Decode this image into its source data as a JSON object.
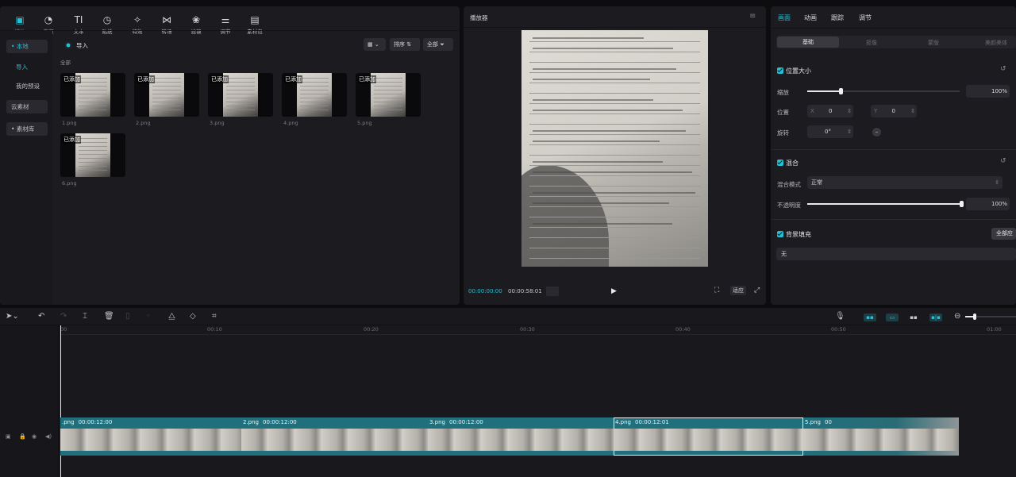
{
  "toolbar": {
    "items": [
      {
        "label": "媒体",
        "icon": "media-icon"
      },
      {
        "label": "音频",
        "icon": "audio-icon"
      },
      {
        "label": "文本",
        "icon": "text-icon"
      },
      {
        "label": "贴纸",
        "icon": "sticker-icon"
      },
      {
        "label": "特效",
        "icon": "effects-icon"
      },
      {
        "label": "转场",
        "icon": "transition-icon"
      },
      {
        "label": "滤镜",
        "icon": "filter-icon"
      },
      {
        "label": "调节",
        "icon": "adjust-icon"
      },
      {
        "label": "素材包",
        "icon": "material-pack-icon"
      }
    ]
  },
  "sidebar": {
    "items": [
      {
        "label": "• 本地"
      },
      {
        "label": "导入"
      },
      {
        "label": "我的预设"
      },
      {
        "label": "云素材"
      },
      {
        "label": "• 素材库"
      }
    ]
  },
  "media_panel": {
    "import_label": "导入",
    "sort_label": "排序",
    "filter_label": "全部",
    "section_label": "全部",
    "items": [
      {
        "name": "1.png",
        "tag": "已添加"
      },
      {
        "name": "2.png",
        "tag": "已添加"
      },
      {
        "name": "3.png",
        "tag": "已添加"
      },
      {
        "name": "4.png",
        "tag": "已添加"
      },
      {
        "name": "5.png",
        "tag": "已添加"
      },
      {
        "name": "6.png",
        "tag": "已添加"
      }
    ]
  },
  "player": {
    "title": "播放器",
    "current_time": "00:00:00:00",
    "total_time": "00:00:58:01",
    "ratio_label": "适应"
  },
  "props": {
    "tabs": [
      "画面",
      "动画",
      "跟踪",
      "调节"
    ],
    "subtabs": [
      "基础",
      "抠像",
      "蒙版",
      "美颜美体"
    ],
    "position_size": {
      "title": "位置大小",
      "scale_label": "缩放",
      "scale_value": "100%",
      "scale_fraction": 0.22,
      "position_label": "位置",
      "x_label": "X",
      "x_value": "0",
      "y_label": "Y",
      "y_value": "0",
      "rotate_label": "旋转",
      "rotate_value": "0°"
    },
    "blend": {
      "title": "混合",
      "mode_label": "混合模式",
      "mode_value": "正常",
      "opacity_label": "不透明度",
      "opacity_value": "100%",
      "opacity_fraction": 1.0
    },
    "background": {
      "title": "背景填充",
      "apply_all": "全部应",
      "value": "无"
    }
  },
  "timeline": {
    "ruler": [
      "00",
      "00:10",
      "00:20",
      "00:30",
      "00:40",
      "00:50",
      "01:00"
    ],
    "clips": [
      {
        "name": ".png",
        "duration": "00:00:12:00"
      },
      {
        "name": "2.png",
        "duration": "00:00:12:00"
      },
      {
        "name": "3.png",
        "duration": "00:00:12:00"
      },
      {
        "name": "4.png",
        "duration": "00:00:12:01"
      },
      {
        "name": "5.png",
        "duration": "00"
      }
    ]
  },
  "colors": {
    "accent": "#22c1d6",
    "panel": "#1c1b20",
    "background": "#0d0d0f",
    "clip": "#1f6f7c"
  }
}
